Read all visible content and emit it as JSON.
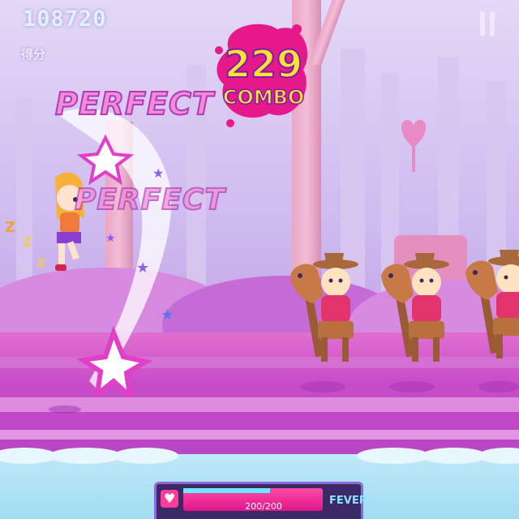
{
  "hud": {
    "score": "108720",
    "score_label": "得分",
    "pause_icon": "pause-icon"
  },
  "combo": {
    "count": "229",
    "label": "COMBO"
  },
  "judgements": {
    "upper": "PERFECT",
    "lower": "PERFECT"
  },
  "health": {
    "value_text": "200/200",
    "fill_fraction": 1.0,
    "fever_label": "FEVER",
    "heart_icon": "heart-icon"
  },
  "colors": {
    "combo_yellow": "#ffe03a",
    "combo_outline": "#7a1fa0",
    "ground_magenta": "#c94dc8",
    "hp_pink": "#e0168a",
    "fever_cyan": "#8ae3ff"
  }
}
